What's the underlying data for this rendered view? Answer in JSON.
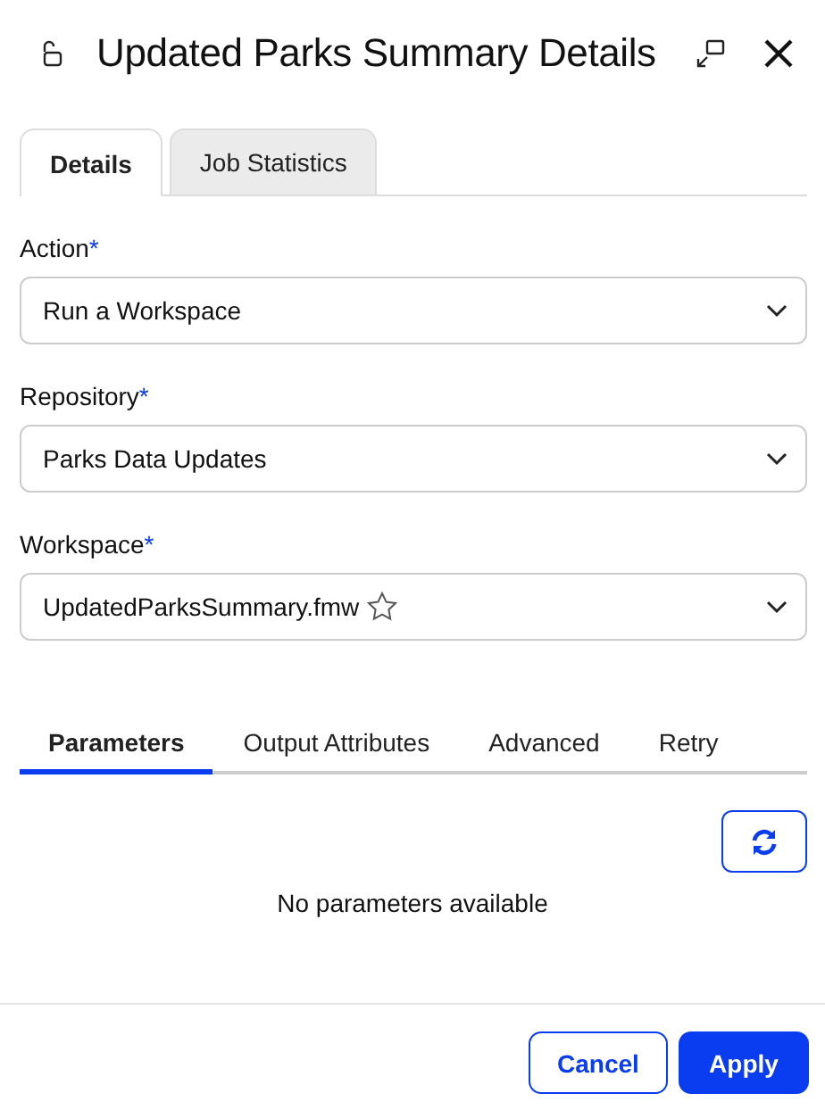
{
  "window": {
    "title": "Updated Parks Summary Details"
  },
  "tabs": [
    {
      "label": "Details",
      "selected": true
    },
    {
      "label": "Job Statistics",
      "selected": false
    }
  ],
  "fields": [
    {
      "label": "Action",
      "required_mark": "*",
      "value": "Run a Workspace",
      "favorite_icon": false
    },
    {
      "label": "Repository",
      "required_mark": "*",
      "value": "Parks Data Updates",
      "favorite_icon": false
    },
    {
      "label": "Workspace",
      "required_mark": "*",
      "value": "UpdatedParksSummary.fmw",
      "favorite_icon": true
    }
  ],
  "sub_tabs": [
    {
      "label": "Parameters",
      "selected": true
    },
    {
      "label": "Output Attributes",
      "selected": false
    },
    {
      "label": "Advanced",
      "selected": false
    },
    {
      "label": "Retry",
      "selected": false
    }
  ],
  "empty_message": "No parameters available",
  "buttons": [
    {
      "label": "Cancel",
      "kind": "secondary"
    },
    {
      "label": "Apply",
      "kind": "primary"
    }
  ]
}
